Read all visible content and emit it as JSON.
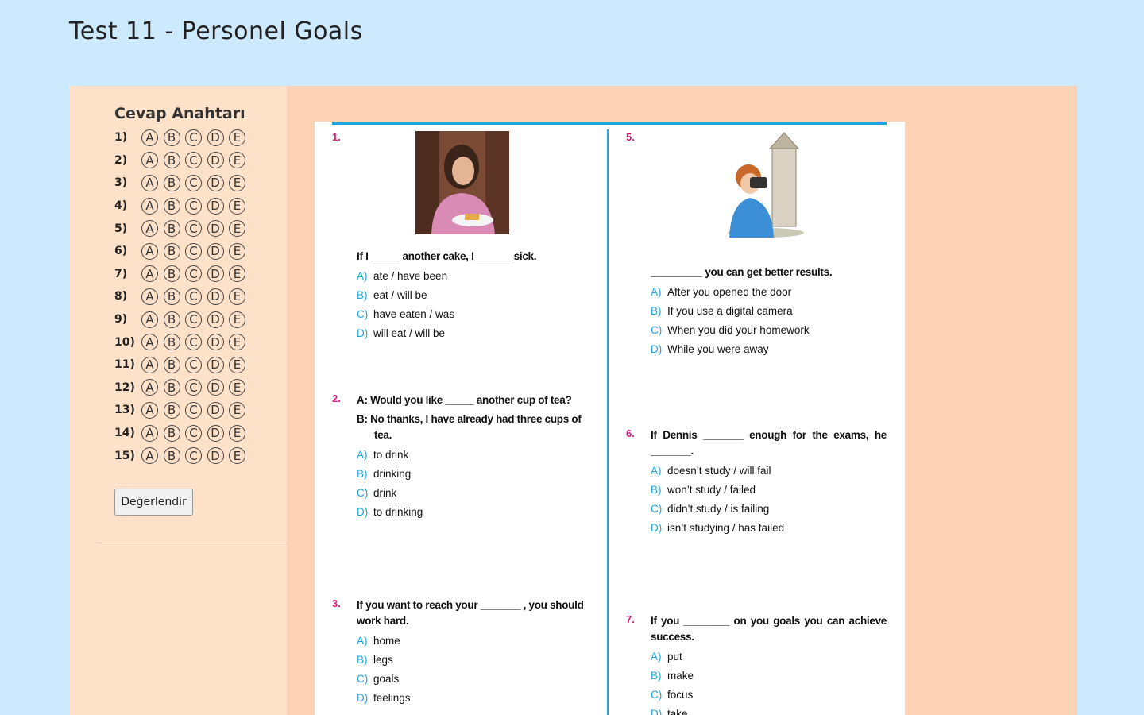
{
  "page": {
    "title": "Test 11 - Personel Goals"
  },
  "answer_key": {
    "title": "Cevap Anahtarı",
    "options": [
      "A",
      "B",
      "C",
      "D",
      "E"
    ],
    "rows": [
      "1)",
      "2)",
      "3)",
      "4)",
      "5)",
      "6)",
      "7)",
      "8)",
      "9)",
      "10)",
      "11)",
      "12)",
      "13)",
      "14)",
      "15)"
    ],
    "submit_label": "Değerlendir"
  },
  "questions": {
    "q1": {
      "num": "1.",
      "stem": "If I _____ another cake, I ______ sick.",
      "options": [
        {
          "l": "A)",
          "t": "ate / have been"
        },
        {
          "l": "B)",
          "t": "eat / will be"
        },
        {
          "l": "C)",
          "t": "have eaten / was"
        },
        {
          "l": "D)",
          "t": "will eat / will be"
        }
      ]
    },
    "q2": {
      "num": "2.",
      "line1": "A: Would you like _____ another cup of tea?",
      "line2": "B: No thanks, I have already had three cups of tea.",
      "options": [
        {
          "l": "A)",
          "t": "to drink"
        },
        {
          "l": "B)",
          "t": "drinking"
        },
        {
          "l": "C)",
          "t": "drink"
        },
        {
          "l": "D)",
          "t": "to drinking"
        }
      ]
    },
    "q3": {
      "num": "3.",
      "stem": "If you want to reach your _______ , you should work hard.",
      "options": [
        {
          "l": "A)",
          "t": "home"
        },
        {
          "l": "B)",
          "t": "legs"
        },
        {
          "l": "C)",
          "t": "goals"
        },
        {
          "l": "D)",
          "t": "feelings"
        }
      ]
    },
    "q5": {
      "num": "5.",
      "stem": "_________ you can get better results.",
      "options": [
        {
          "l": "A)",
          "t": "After you opened the door"
        },
        {
          "l": "B)",
          "t": "If you use a digital camera"
        },
        {
          "l": "C)",
          "t": "When you did your homework"
        },
        {
          "l": "D)",
          "t": "While you were away"
        }
      ]
    },
    "q6": {
      "num": "6.",
      "stem": "If Dennis _______ enough for the exams, he _______.",
      "options": [
        {
          "l": "A)",
          "t": "doesn’t study / will fail"
        },
        {
          "l": "B)",
          "t": "won’t study / failed"
        },
        {
          "l": "C)",
          "t": "didn’t study / is failing"
        },
        {
          "l": "D)",
          "t": "isn’t studying / has failed"
        }
      ]
    },
    "q7": {
      "num": "7.",
      "stem": "If you ________ on you goals you can achieve success.",
      "options": [
        {
          "l": "A)",
          "t": "put"
        },
        {
          "l": "B)",
          "t": "make"
        },
        {
          "l": "C)",
          "t": "focus"
        },
        {
          "l": "D)",
          "t": "take"
        }
      ]
    }
  },
  "colors": {
    "background": "#cde9fd",
    "panel": "#fcd2b5",
    "sidebar": "#fee1c9",
    "accent_blue": "#1ea5de",
    "number_magenta": "#d81b7a"
  }
}
